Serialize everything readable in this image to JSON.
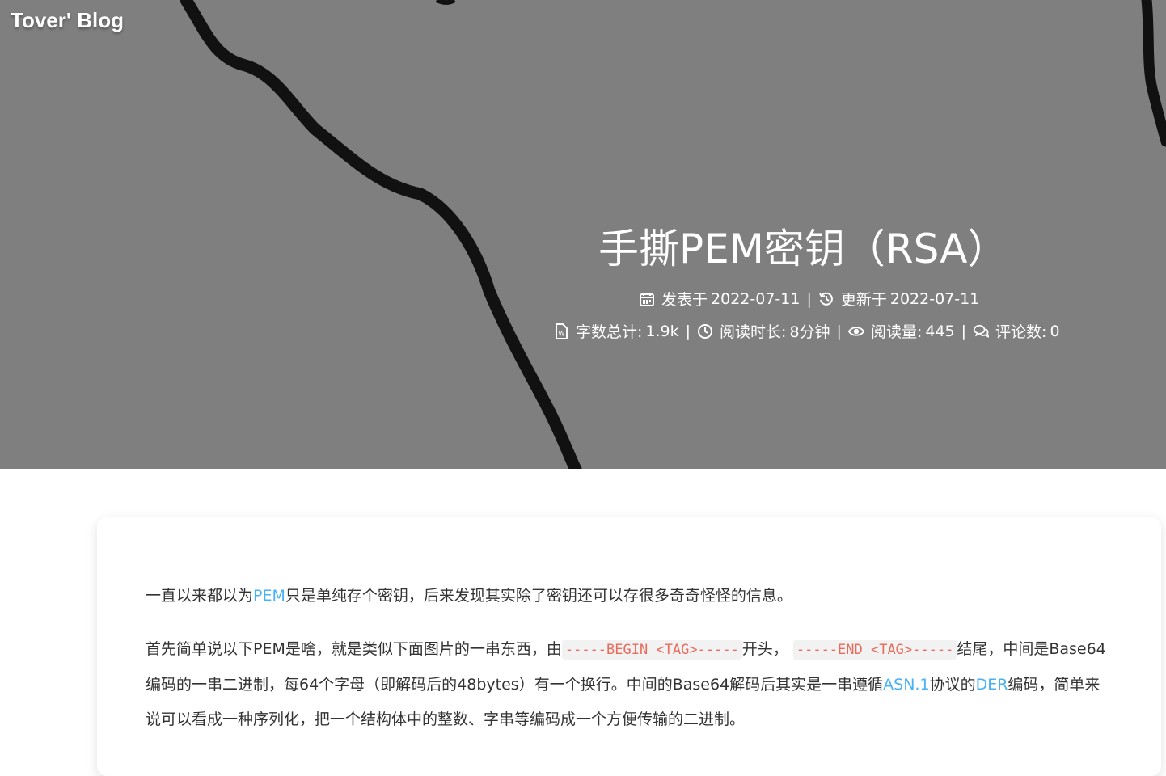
{
  "site": {
    "title": "Tover' Blog"
  },
  "post": {
    "title": "手撕PEM密钥（RSA）",
    "meta": {
      "published_label": "发表于",
      "published_date": "2022-07-11",
      "updated_label": "更新于",
      "updated_date": "2022-07-11",
      "word_count_label": "字数总计:",
      "word_count": "1.9k",
      "read_time_label": "阅读时长:",
      "read_time": "8分钟",
      "views_label": "阅读量:",
      "views": "445",
      "comments_label": "评论数:",
      "comments": "0",
      "separator": "|"
    },
    "icons": [
      "calendar-icon",
      "history-icon",
      "file-word-icon",
      "clock-icon",
      "eye-icon",
      "comments-icon"
    ]
  },
  "content": {
    "p1": {
      "before": "一直以来都以为",
      "link": "PEM",
      "after": "只是单纯存个密钥，后来发现其实除了密钥还可以存很多奇奇怪怪的信息。"
    },
    "p2": {
      "t1": "首先简单说以下PEM是啥，就是类似下面图片的一串东西，由",
      "code1": "-----BEGIN <TAG>-----",
      "t2": "开头，",
      "code2": "-----END <TAG>-----",
      "t3": "结尾，中间是Base64编码的一串二进制，每64个字母（即解码后的48bytes）有一个换行。中间的Base64解码后其实是一串遵循",
      "link1": "ASN.1",
      "t4": "协议的",
      "link2": "DER",
      "t5": "编码，简单来说可以看成一种序列化，把一个结构体中的整数、字串等编码成一个方便传输的二进制。"
    }
  },
  "colors": {
    "header_bg": "#7f7f7f",
    "link": "#49b1f5",
    "code_text": "#e96b5c",
    "body_text": "#333333"
  }
}
